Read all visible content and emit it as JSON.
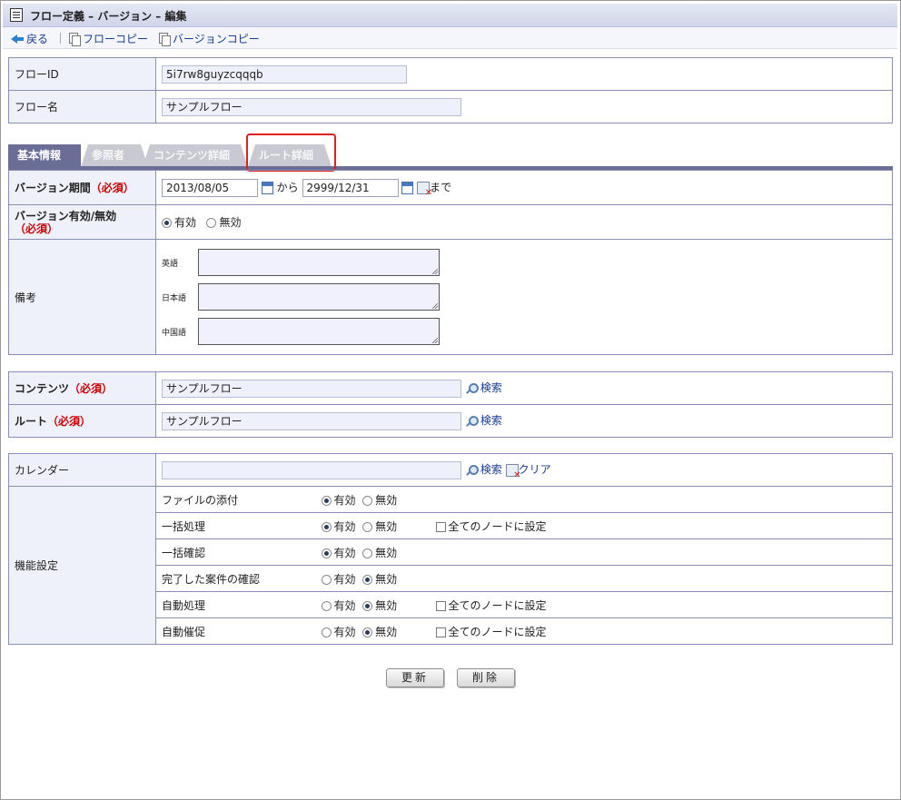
{
  "title": "フロー定義 – バージョン – 編集",
  "toolbar": {
    "back": "戻る",
    "flow_copy": "フローコピー",
    "version_copy": "バージョンコピー"
  },
  "basic": {
    "flow_id_label": "フローID",
    "flow_id_value": "5i7rw8guyzcqqqb",
    "flow_name_label": "フロー名",
    "flow_name_value": "サンプルフロー"
  },
  "tabs": [
    "基本情報",
    "参照者",
    "コンテンツ詳細",
    "ルート詳細"
  ],
  "version": {
    "period_label": "バージョン期間",
    "required": "（必須）",
    "from": "2013/08/05",
    "kara": "から",
    "to": "2999/12/31",
    "made": "まで",
    "valid_label": "バージョン有効/無効",
    "valid": "有効",
    "invalid": "無効",
    "notes_label": "備考",
    "lang_en": "英語",
    "lang_ja": "日本語",
    "lang_zh": "中国語"
  },
  "content": {
    "content_label": "コンテンツ",
    "content_value": "サンプルフロー",
    "route_label": "ルート",
    "route_value": "サンプルフロー",
    "search": "検索"
  },
  "calendar": {
    "label": "カレンダー",
    "value": "",
    "search": "検索",
    "clear": "クリア"
  },
  "features": {
    "label": "機能設定",
    "on": "有効",
    "off": "無効",
    "all_nodes": "全てのノードに設定",
    "rows": [
      {
        "name": "ファイルの添付",
        "value": "on",
        "all_nodes": false
      },
      {
        "name": "一括処理",
        "value": "on",
        "all_nodes": true
      },
      {
        "name": "一括確認",
        "value": "on",
        "all_nodes": false
      },
      {
        "name": "完了した案件の確認",
        "value": "off",
        "all_nodes": false
      },
      {
        "name": "自動処理",
        "value": "off",
        "all_nodes": true
      },
      {
        "name": "自動催促",
        "value": "off",
        "all_nodes": true
      }
    ]
  },
  "buttons": {
    "update": "更新",
    "delete": "削除"
  }
}
